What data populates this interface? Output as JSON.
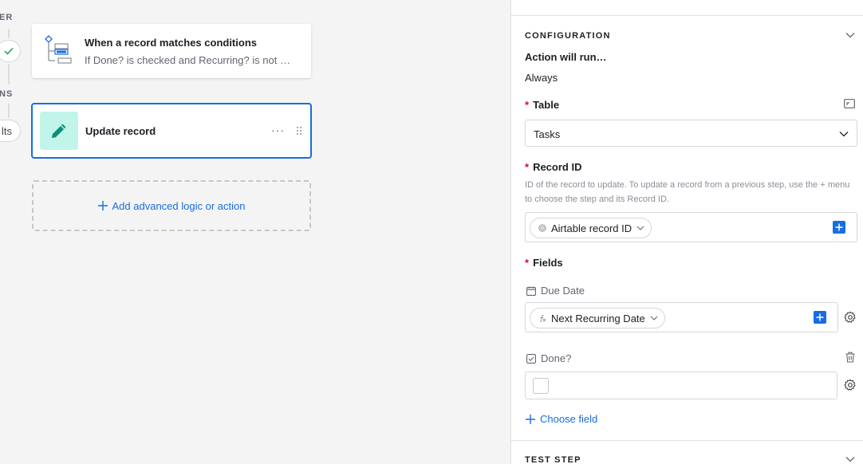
{
  "rail": {
    "top_label": "ER",
    "mid_label": "NS",
    "pill_label": "lts"
  },
  "trigger_card": {
    "title": "When a record matches conditions",
    "subtitle": "If Done? is checked and Recurring? is not …"
  },
  "action_card": {
    "title": "Update record",
    "more": "···"
  },
  "add_step": {
    "label": "Add advanced logic or action"
  },
  "panel": {
    "configuration": {
      "heading": "CONFIGURATION",
      "run_label": "Action will run…",
      "run_value": "Always"
    },
    "table": {
      "required": "*",
      "label": "Table",
      "value": "Tasks"
    },
    "record_id": {
      "required": "*",
      "label": "Record ID",
      "help": "ID of the record to update. To update a record from a previous step, use the + menu to choose the step and its Record ID.",
      "token": "Airtable record ID"
    },
    "fields": {
      "required": "*",
      "label": "Fields",
      "due_date": {
        "label": "Due Date",
        "token": "Next Recurring Date"
      },
      "done": {
        "label": "Done?"
      },
      "choose_field": "Choose field"
    },
    "test_step": {
      "heading": "TEST STEP"
    }
  },
  "colors": {
    "accent": "#166ee1",
    "required": "#dc043b",
    "action_icon_bg": "#c2f5e9",
    "action_icon_fg": "#0a8f76",
    "success": "#1fa14b"
  }
}
